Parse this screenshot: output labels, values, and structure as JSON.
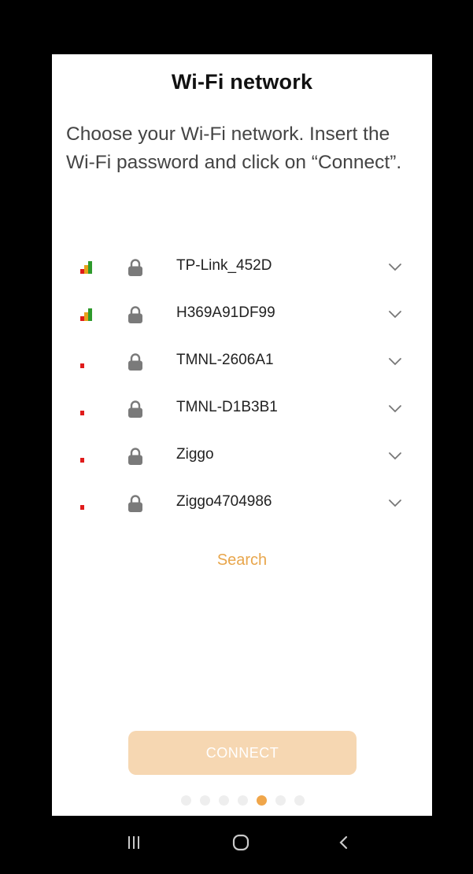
{
  "title": "Wi-Fi network",
  "instructions": "Choose your Wi-Fi network. Insert the Wi-Fi password and click on “Connect”.",
  "networks": [
    {
      "name": "TP-Link_452D",
      "signal_bars": 3,
      "locked": true
    },
    {
      "name": "H369A91DF99",
      "signal_bars": 3,
      "locked": true
    },
    {
      "name": "TMNL-2606A1",
      "signal_bars": 1,
      "locked": true
    },
    {
      "name": "TMNL-D1B3B1",
      "signal_bars": 1,
      "locked": true
    },
    {
      "name": "Ziggo",
      "signal_bars": 1,
      "locked": true
    },
    {
      "name": "Ziggo4704986",
      "signal_bars": 1,
      "locked": true
    }
  ],
  "search_label": "Search",
  "connect_label": "CONNECT",
  "pagination": {
    "total": 7,
    "active_index": 4
  },
  "icons": {
    "signal": "wifi-signal-icon",
    "lock": "lock-icon",
    "expand": "chevron-down-icon",
    "nav_recent": "recent-apps-icon",
    "nav_home": "home-icon",
    "nav_back": "back-icon"
  },
  "colors": {
    "accent": "#e8a64c",
    "connect_disabled": "#f6d7b2",
    "signal_bar_1": "#e01b1b",
    "signal_bar_2": "#e7a21b",
    "signal_bar_3": "#2e9a2c",
    "lock": "#7a7a7a"
  }
}
